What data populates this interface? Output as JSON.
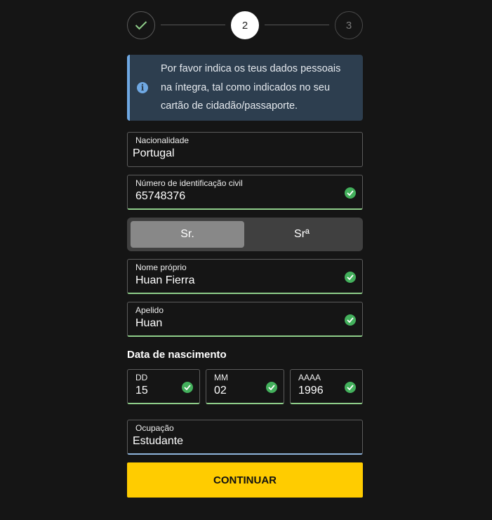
{
  "stepper": {
    "step1": "",
    "step2": "2",
    "step3": "3"
  },
  "info": {
    "text": "Por favor indica os teus dados pessoais na íntegra, tal como indicados no seu cartão de cidadão/passaporte."
  },
  "fields": {
    "nationality": {
      "label": "Nacionalidade",
      "value": "Portugal"
    },
    "id_number": {
      "label": "Número de identificação civil",
      "value": "65748376"
    },
    "first_name": {
      "label": "Nome próprio",
      "value": "Huan Fierra"
    },
    "surname": {
      "label": "Apelido",
      "value": "Huan"
    },
    "occupation": {
      "label": "Ocupação",
      "value": "Estudante"
    }
  },
  "title_toggle": {
    "options": [
      "Sr.",
      "Srª"
    ],
    "selected": "Sr."
  },
  "dob": {
    "title": "Data de nascimento",
    "day": {
      "label": "DD",
      "value": "15"
    },
    "month": {
      "label": "MM",
      "value": "02"
    },
    "year": {
      "label": "AAAA",
      "value": "1996"
    }
  },
  "continue_label": "CONTINUAR",
  "colors": {
    "accent": "#ffcc00",
    "valid": "#43b05c",
    "info_bg": "#2d3e4f",
    "info_border": "#6fa8e3"
  }
}
